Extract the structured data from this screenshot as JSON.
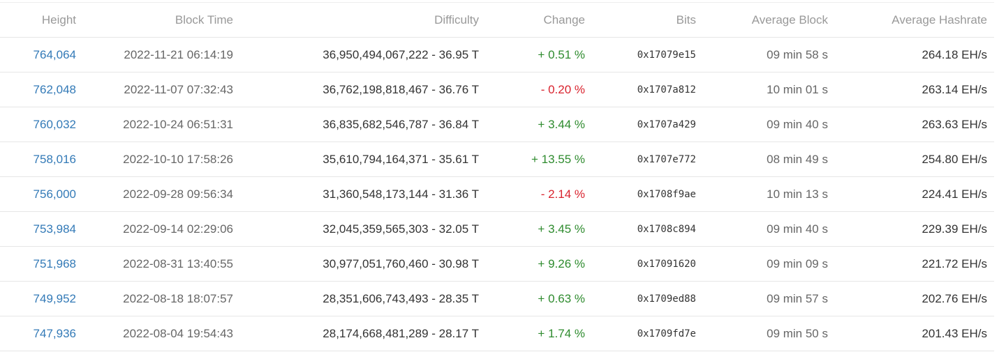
{
  "table": {
    "headers": {
      "height": "Height",
      "block_time": "Block Time",
      "difficulty": "Difficulty",
      "change": "Change",
      "bits": "Bits",
      "average_block": "Average Block",
      "average_hashrate": "Average Hashrate"
    },
    "rows": [
      {
        "height": "764,064",
        "block_time": "2022-11-21 06:14:19",
        "difficulty": "36,950,494,067,222 - 36.95 T",
        "change": "+ 0.51 %",
        "bits": "0x17079e15",
        "average_block": "09 min 58 s",
        "average_hashrate": "264.18 EH/s"
      },
      {
        "height": "762,048",
        "block_time": "2022-11-07 07:32:43",
        "difficulty": "36,762,198,818,467 - 36.76 T",
        "change": "- 0.20 %",
        "bits": "0x1707a812",
        "average_block": "10 min 01 s",
        "average_hashrate": "263.14 EH/s"
      },
      {
        "height": "760,032",
        "block_time": "2022-10-24 06:51:31",
        "difficulty": "36,835,682,546,787 - 36.84 T",
        "change": "+ 3.44 %",
        "bits": "0x1707a429",
        "average_block": "09 min 40 s",
        "average_hashrate": "263.63 EH/s"
      },
      {
        "height": "758,016",
        "block_time": "2022-10-10 17:58:26",
        "difficulty": "35,610,794,164,371 - 35.61 T",
        "change": "+ 13.55 %",
        "bits": "0x1707e772",
        "average_block": "08 min 49 s",
        "average_hashrate": "254.80 EH/s"
      },
      {
        "height": "756,000",
        "block_time": "2022-09-28 09:56:34",
        "difficulty": "31,360,548,173,144 - 31.36 T",
        "change": "- 2.14 %",
        "bits": "0x1708f9ae",
        "average_block": "10 min 13 s",
        "average_hashrate": "224.41 EH/s"
      },
      {
        "height": "753,984",
        "block_time": "2022-09-14 02:29:06",
        "difficulty": "32,045,359,565,303 - 32.05 T",
        "change": "+ 3.45 %",
        "bits": "0x1708c894",
        "average_block": "09 min 40 s",
        "average_hashrate": "229.39 EH/s"
      },
      {
        "height": "751,968",
        "block_time": "2022-08-31 13:40:55",
        "difficulty": "30,977,051,760,460 - 30.98 T",
        "change": "+ 9.26 %",
        "bits": "0x17091620",
        "average_block": "09 min 09 s",
        "average_hashrate": "221.72 EH/s"
      },
      {
        "height": "749,952",
        "block_time": "2022-08-18 18:07:57",
        "difficulty": "28,351,606,743,493 - 28.35 T",
        "change": "+ 0.63 %",
        "bits": "0x1709ed88",
        "average_block": "09 min 57 s",
        "average_hashrate": "202.76 EH/s"
      },
      {
        "height": "747,936",
        "block_time": "2022-08-04 19:54:43",
        "difficulty": "28,174,668,481,289 - 28.17 T",
        "change": "+ 1.74 %",
        "bits": "0x1709fd7e",
        "average_block": "09 min 50 s",
        "average_hashrate": "201.43 EH/s"
      }
    ]
  },
  "colors": {
    "link": "#337ab7",
    "positive": "#2e8b2e",
    "negative": "#d9232e",
    "header_text": "#999999"
  }
}
